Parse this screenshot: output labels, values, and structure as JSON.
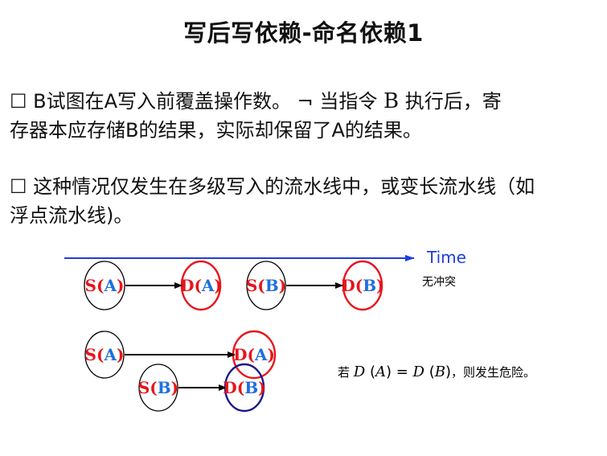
{
  "title": "写后写依赖-命名依赖1",
  "para1": {
    "checkbox": "☐",
    "line1_a": " B试图在A写入前覆盖操作数。 ",
    "neg": "¬",
    "line1_b": " 当指令 ",
    "instr": "B",
    "line1_c": " 执行后，寄",
    "line2": "存器本应存储B的结果，实际却保留了A的结果。"
  },
  "para2": {
    "checkbox": "☐",
    "line1": " 这种情况仅发生在多级写入的流水线中，或变长流水线（如",
    "line2": "浮点流水线)。"
  },
  "diagram": {
    "time_label": "Time",
    "no_conflict": "无冲突",
    "row1": [
      {
        "s": "S",
        "reg": "A"
      },
      {
        "s": "D",
        "reg": "A"
      },
      {
        "s": "S",
        "reg": "B"
      },
      {
        "s": "D",
        "reg": "B"
      }
    ],
    "row2": {
      "s": "S",
      "reg": "A",
      "d": "D"
    },
    "row3": {
      "s": "S",
      "reg": "B",
      "d": "D"
    },
    "hazard": {
      "prefix": "若 ",
      "D1": "D",
      "A": "A",
      "eq": "=",
      "D2": "D",
      "B": "B",
      "suffix": "，则发生危险。"
    },
    "colors": {
      "red": "#e8141b",
      "blue": "#1f6fe0",
      "navy": "#1a1a8c",
      "time_line": "#1f3fd6"
    }
  }
}
